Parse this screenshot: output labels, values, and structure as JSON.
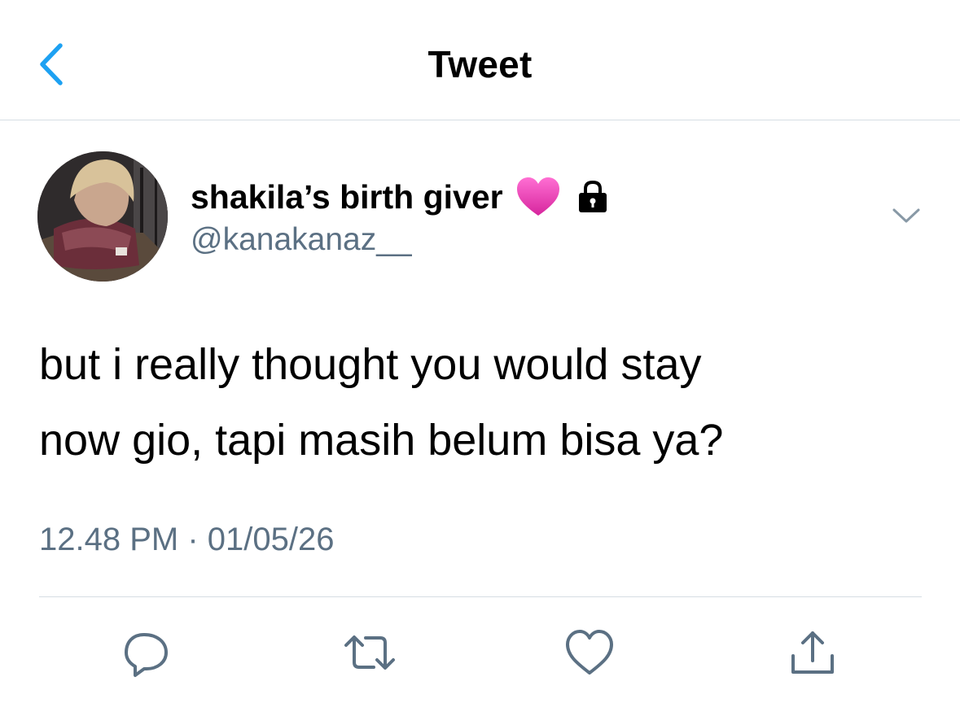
{
  "header": {
    "title": "Tweet",
    "back_icon": "chevron-left-icon"
  },
  "author": {
    "display_name": "shakila’s birth giver",
    "handle": "@kanakanaz__",
    "name_emoji": "pink-heart",
    "protected_icon": "lock-icon"
  },
  "tweet": {
    "text_lines": [
      "but i really thought you would stay",
      "now gio, tapi masih belum bisa ya?"
    ],
    "timestamp": "12.48 PM · 01/05/26"
  },
  "actions": [
    {
      "name": "reply",
      "icon": "reply-icon"
    },
    {
      "name": "retweet",
      "icon": "retweet-icon"
    },
    {
      "name": "like",
      "icon": "heart-icon"
    },
    {
      "name": "share",
      "icon": "share-icon"
    }
  ],
  "colors": {
    "accent": "#1da1f2",
    "secondary_text": "#5b7083",
    "divider": "#d6dde3",
    "heart_emoji": "#e83fb5"
  }
}
